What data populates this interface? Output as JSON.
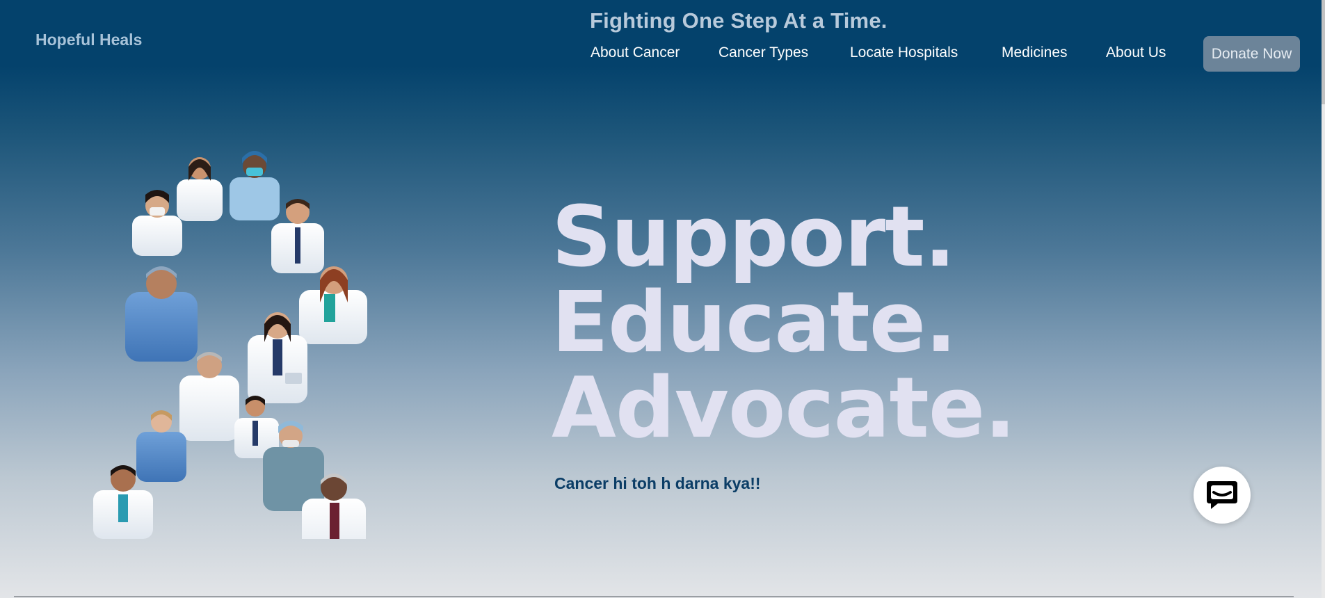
{
  "header": {
    "brand": "Hopeful Heals",
    "tagline": "Fighting One Step At a Time.",
    "nav": [
      {
        "label": "About Cancer"
      },
      {
        "label": "Cancer Types"
      },
      {
        "label": "Locate Hospitals"
      },
      {
        "label": "Medicines"
      },
      {
        "label": "About Us"
      }
    ],
    "donate_label": "Donate Now"
  },
  "hero": {
    "lines": [
      "Support.",
      "Educate.",
      "Advocate."
    ],
    "subtitle": "Cancer hi toh h darna kya!!"
  },
  "collage": {
    "icon": "doctors-collage-image"
  },
  "chat": {
    "icon": "chat-icon"
  },
  "colors": {
    "header_bg": "#04426c",
    "brand": "#a8c3d9",
    "hero_text": "#e1e1f1",
    "subtitle": "#0b3d66",
    "donate_bg": "#6c8499"
  }
}
